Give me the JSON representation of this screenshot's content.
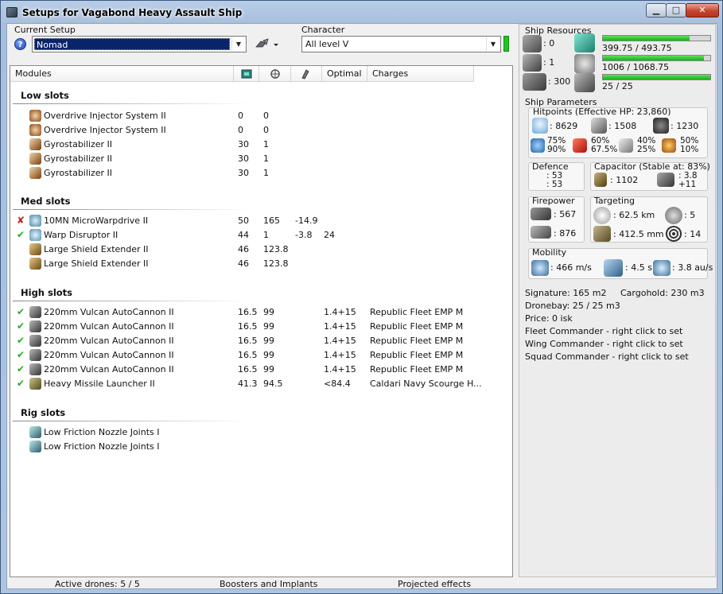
{
  "window": {
    "title": "Setups for Vagabond Heavy Assault Ship",
    "min_glyph": "▁",
    "max_glyph": "□",
    "close_glyph": "✕"
  },
  "setup": {
    "label": "Current Setup",
    "value": "Nomad",
    "help_glyph": "?"
  },
  "character": {
    "label": "Character",
    "value": "All level V"
  },
  "modules": {
    "headers": {
      "name": "Modules",
      "optimal": "Optimal",
      "charges": "Charges"
    },
    "sections": [
      {
        "title": "Low slots",
        "rows": [
          {
            "status": "",
            "icon": "overdrive-icon",
            "name": "Overdrive Injector System II",
            "c1": "0",
            "c2": "0",
            "c3": "",
            "c4": "",
            "c5": ""
          },
          {
            "status": "",
            "icon": "overdrive-icon",
            "name": "Overdrive Injector System II",
            "c1": "0",
            "c2": "0",
            "c3": "",
            "c4": "",
            "c5": ""
          },
          {
            "status": "",
            "icon": "gyrostabilizer-icon",
            "name": "Gyrostabilizer II",
            "c1": "30",
            "c2": "1",
            "c3": "",
            "c4": "",
            "c5": ""
          },
          {
            "status": "",
            "icon": "gyrostabilizer-icon",
            "name": "Gyrostabilizer II",
            "c1": "30",
            "c2": "1",
            "c3": "",
            "c4": "",
            "c5": ""
          },
          {
            "status": "",
            "icon": "gyrostabilizer-icon",
            "name": "Gyrostabilizer II",
            "c1": "30",
            "c2": "1",
            "c3": "",
            "c4": "",
            "c5": ""
          }
        ]
      },
      {
        "title": "Med slots",
        "rows": [
          {
            "status": "✘",
            "icon": "microwarpdrive-icon",
            "name": "10MN MicroWarpdrive II",
            "c1": "50",
            "c2": "165",
            "c3": "-14.9",
            "c4": "",
            "c5": ""
          },
          {
            "status": "✔",
            "icon": "warp-disruptor-icon",
            "name": "Warp Disruptor II",
            "c1": "44",
            "c2": "1",
            "c3": "-3.8",
            "c4": "24",
            "c5": ""
          },
          {
            "status": "",
            "icon": "shield-extender-icon",
            "name": "Large Shield Extender II",
            "c1": "46",
            "c2": "123.8",
            "c3": "",
            "c4": "",
            "c5": ""
          },
          {
            "status": "",
            "icon": "shield-extender-icon",
            "name": "Large Shield Extender II",
            "c1": "46",
            "c2": "123.8",
            "c3": "",
            "c4": "",
            "c5": ""
          }
        ]
      },
      {
        "title": "High slots",
        "rows": [
          {
            "status": "✔",
            "icon": "autocannon-icon",
            "name": "220mm Vulcan AutoCannon II",
            "c1": "16.5",
            "c2": "99",
            "c3": "",
            "c4": "1.4+15",
            "c5": "Republic Fleet EMP M"
          },
          {
            "status": "✔",
            "icon": "autocannon-icon",
            "name": "220mm Vulcan AutoCannon II",
            "c1": "16.5",
            "c2": "99",
            "c3": "",
            "c4": "1.4+15",
            "c5": "Republic Fleet EMP M"
          },
          {
            "status": "✔",
            "icon": "autocannon-icon",
            "name": "220mm Vulcan AutoCannon II",
            "c1": "16.5",
            "c2": "99",
            "c3": "",
            "c4": "1.4+15",
            "c5": "Republic Fleet EMP M"
          },
          {
            "status": "✔",
            "icon": "autocannon-icon",
            "name": "220mm Vulcan AutoCannon II",
            "c1": "16.5",
            "c2": "99",
            "c3": "",
            "c4": "1.4+15",
            "c5": "Republic Fleet EMP M"
          },
          {
            "status": "✔",
            "icon": "autocannon-icon",
            "name": "220mm Vulcan AutoCannon II",
            "c1": "16.5",
            "c2": "99",
            "c3": "",
            "c4": "1.4+15",
            "c5": "Republic Fleet EMP M"
          },
          {
            "status": "✔",
            "icon": "missile-launcher-icon",
            "name": "Heavy Missile Launcher II",
            "c1": "41.3",
            "c2": "94.5",
            "c3": "",
            "c4": "<84.4",
            "c5": "Caldari Navy Scourge H..."
          }
        ]
      },
      {
        "title": "Rig slots",
        "rows": [
          {
            "status": "",
            "icon": "rig-icon",
            "name": "Low Friction Nozzle Joints I",
            "c1": "",
            "c2": "",
            "c3": "",
            "c4": "",
            "c5": ""
          },
          {
            "status": "",
            "icon": "rig-icon",
            "name": "Low Friction Nozzle Joints I",
            "c1": "",
            "c2": "",
            "c3": "",
            "c4": "",
            "c5": ""
          }
        ]
      }
    ]
  },
  "statusbar": {
    "drones": "Active drones: 5 / 5",
    "boosters": "Boosters and Implants",
    "projected": "Projected effects"
  },
  "resources": {
    "title": "Ship Resources",
    "turrets": ": 0",
    "launchers": ": 1",
    "calibration": ": 300",
    "cpu": {
      "text": "399.75 / 493.75",
      "fraction": 0.81
    },
    "powergrid": {
      "text": "1006 / 1068.75",
      "fraction": 0.94
    },
    "drone_bandwidth": {
      "text": "25 / 25",
      "fraction": 1.0
    }
  },
  "params": {
    "title": "Ship Parameters",
    "hitpoints_label": "Hitpoints (Effective HP: 23,860)",
    "shield_hp": ": 8629",
    "armor_hp": ": 1508",
    "hull_hp": ": 1230",
    "res_em": [
      "75%",
      "90%"
    ],
    "res_thermal": [
      "60%",
      "67.5%"
    ],
    "res_kinetic": [
      "40%",
      "25%"
    ],
    "res_explosive": [
      "50%",
      "10%"
    ],
    "defence_label": "Defence",
    "defence_vals": [
      ": 53",
      ": 53"
    ],
    "capacitor_label": "Capacitor (Stable at: 83%)",
    "capacitor_val": ": 1102",
    "capacitor_delta": [
      ": 3.8",
      "+11"
    ],
    "firepower_label": "Firepower",
    "firepower_turret": ": 567",
    "firepower_missile": ": 876",
    "targeting_label": "Targeting",
    "target_range": ": 62.5 km",
    "max_targets": ": 5",
    "scan_res": ": 412.5 mm",
    "sensor_strength": ": 14",
    "mobility_label": "Mobility",
    "speed": ": 466 m/s",
    "align": ": 4.5 s",
    "warp": ": 3.8 au/s"
  },
  "info": {
    "signature": "Signature: 165 m2",
    "cargohold": "Cargohold: 230 m3",
    "dronebay": "Dronebay: 25 / 25 m3",
    "price": "Price: 0 isk",
    "fleet": "Fleet Commander - right click to set",
    "wing": "Wing Commander - right click to set",
    "squad": "Squad Commander - right click to set"
  },
  "colors": {
    "accent_green": "#22c322",
    "error_red": "#c81e1e",
    "ok_green": "#2aa72a",
    "selection_blue": "#0a246a"
  }
}
